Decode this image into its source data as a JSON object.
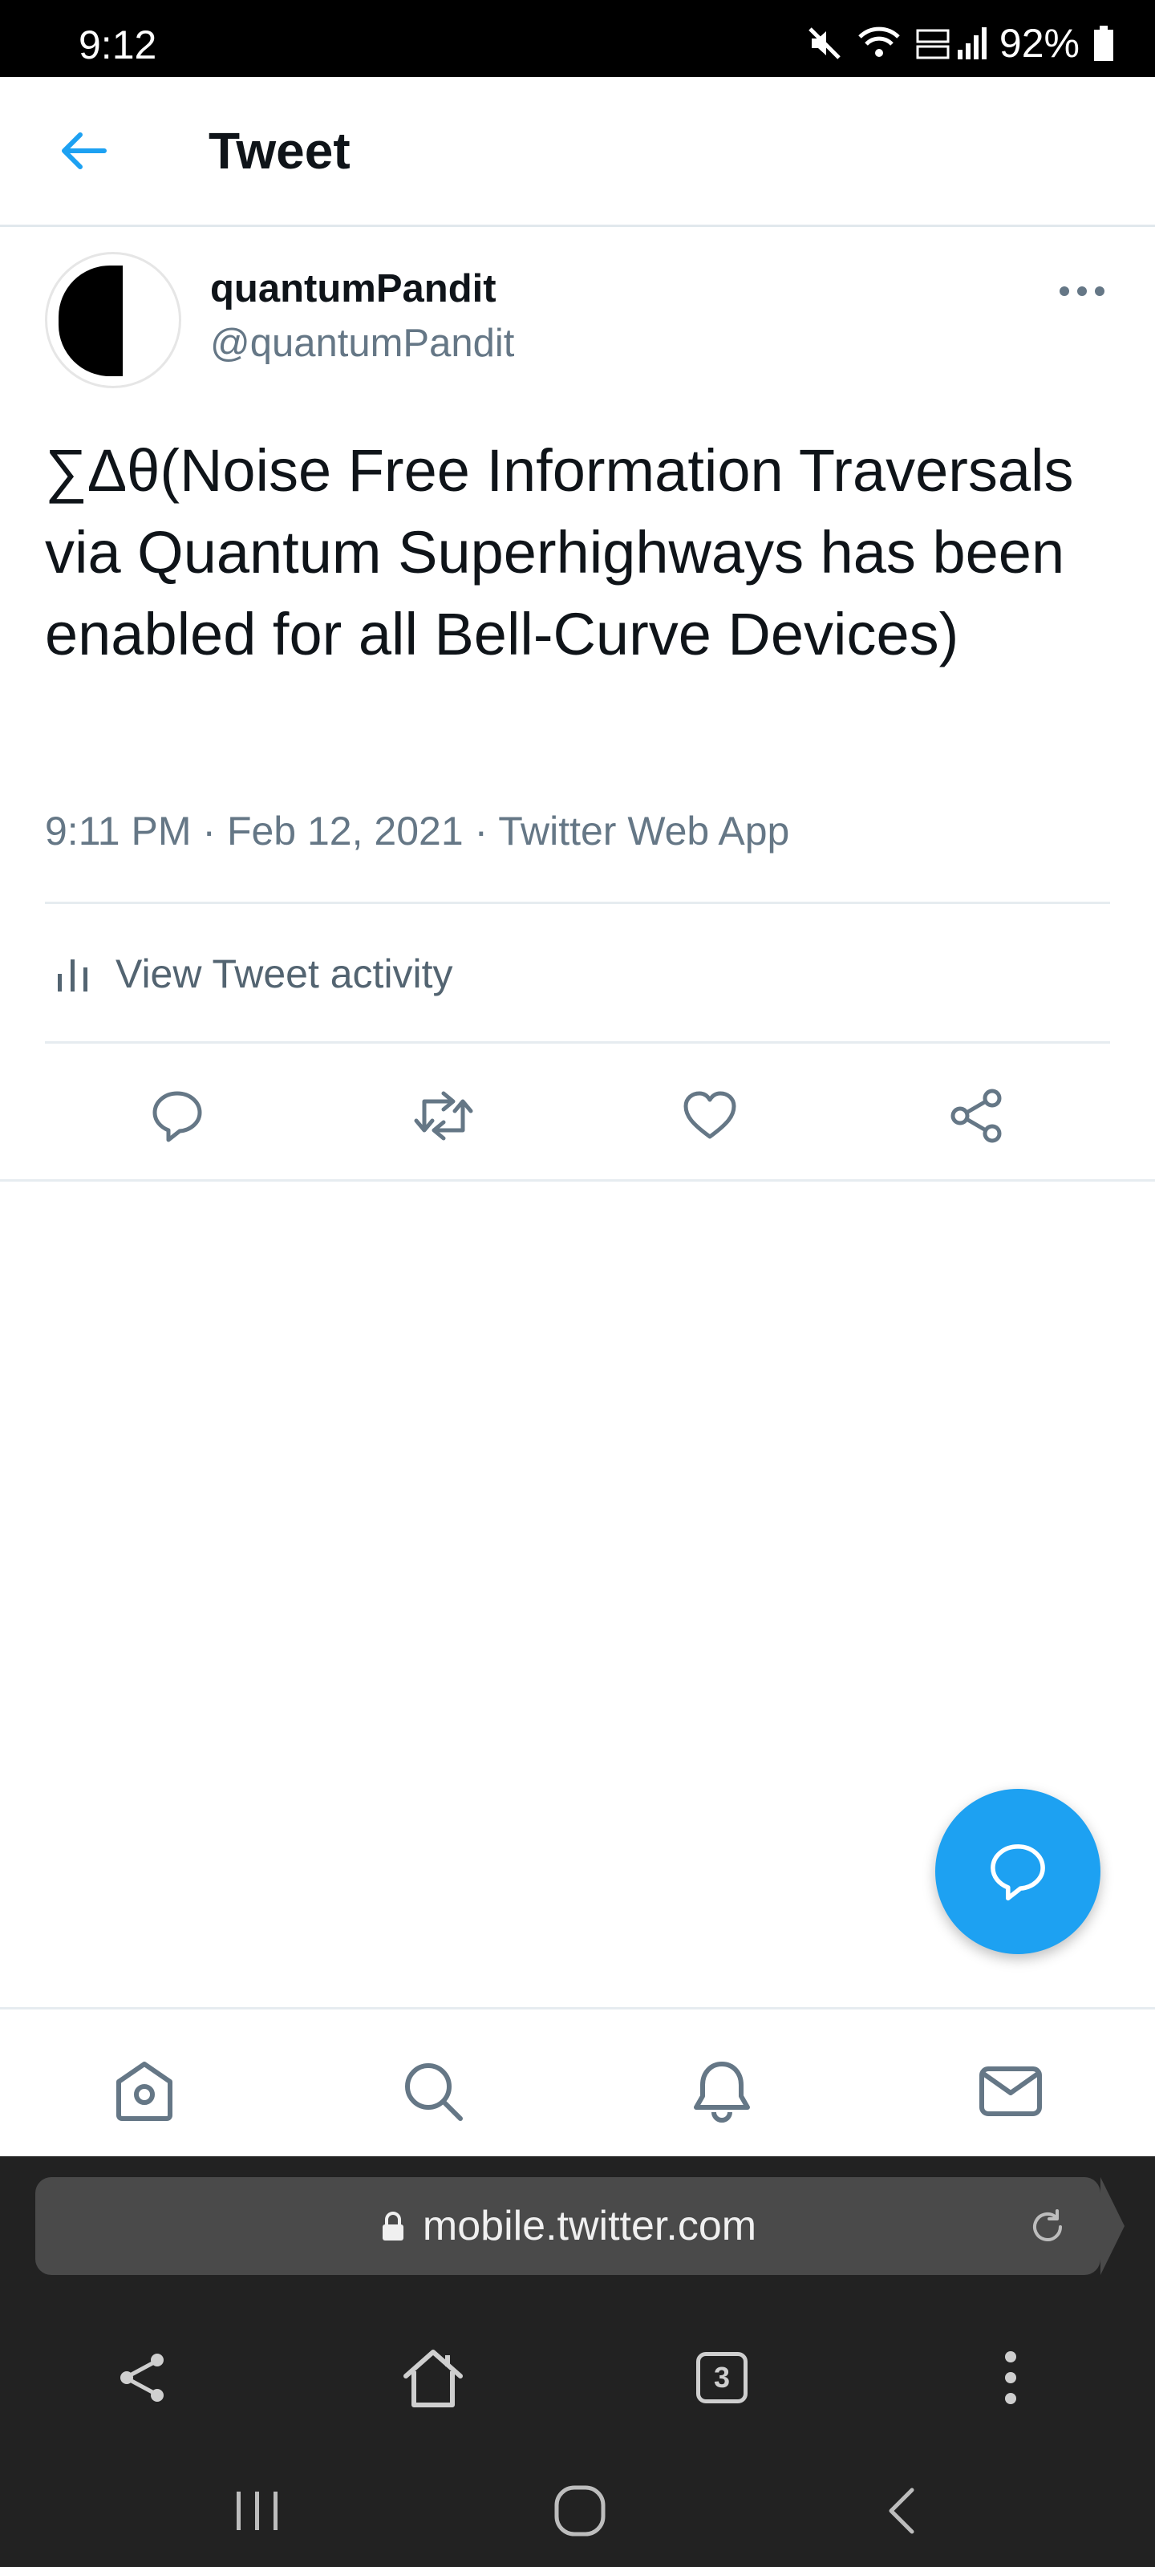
{
  "status_bar": {
    "time": "9:12",
    "battery": "92%"
  },
  "header": {
    "title": "Tweet"
  },
  "tweet": {
    "display_name": "quantumPandit",
    "handle": "@quantumPandit",
    "text": "∑Δθ(Noise Free Information Traversals via Quantum Superhighways has been enabled for all Bell-Curve Devices)",
    "time": "9:11 PM",
    "date": "Feb 12, 2021",
    "source": "Twitter Web App",
    "activity_label": "View Tweet activity"
  },
  "actions": [
    "reply-icon",
    "retweet-icon",
    "like-icon",
    "share-icon"
  ],
  "bottom_nav": [
    "home-icon",
    "search-icon",
    "notifications-icon",
    "messages-icon"
  ],
  "browser": {
    "url": "mobile.twitter.com",
    "tab_count": "3"
  },
  "colors": {
    "accent": "#1da1f2",
    "secondary_text": "#657786",
    "status_bar": "#000000",
    "browser_chrome": "#222222"
  }
}
